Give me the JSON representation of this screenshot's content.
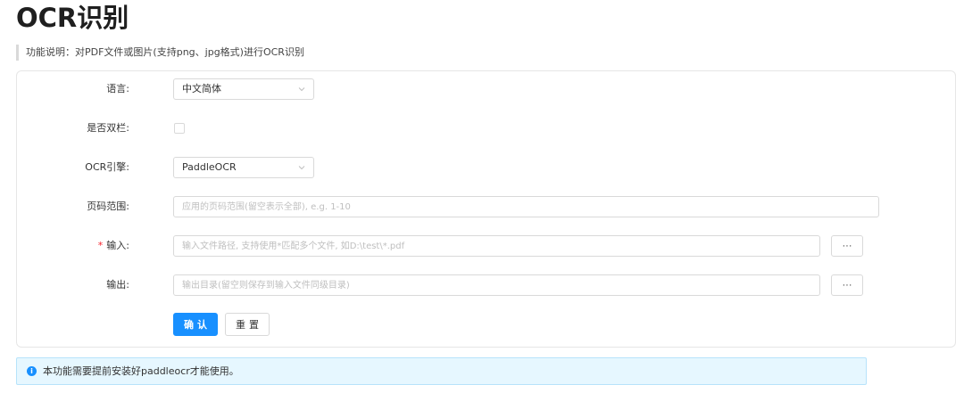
{
  "page": {
    "title": "OCR识别",
    "description": "功能说明：对PDF文件或图片(支持png、jpg格式)进行OCR识别"
  },
  "form": {
    "language": {
      "label": "语言:",
      "value": "中文简体"
    },
    "double_column": {
      "label": "是否双栏:",
      "checked": false
    },
    "engine": {
      "label": "OCR引擎:",
      "value": "PaddleOCR"
    },
    "page_range": {
      "label": "页码范围:",
      "placeholder": "应用的页码范围(留空表示全部), e.g. 1-10"
    },
    "input": {
      "label": "输入:",
      "required_mark": "*",
      "placeholder": "输入文件路径, 支持使用*匹配多个文件, 如D:\\test\\*.pdf",
      "browse_label": "···"
    },
    "output": {
      "label": "输出:",
      "placeholder": "输出目录(留空则保存到输入文件同级目录)",
      "browse_label": "···"
    },
    "submit_label": "确认",
    "reset_label": "重置"
  },
  "alert": {
    "icon": "info-icon",
    "icon_glyph": "i",
    "text": "本功能需要提前安装好paddleocr才能使用。"
  },
  "colors": {
    "primary": "#1890ff",
    "alert_bg": "#e6f7ff",
    "required": "#f5222d"
  }
}
